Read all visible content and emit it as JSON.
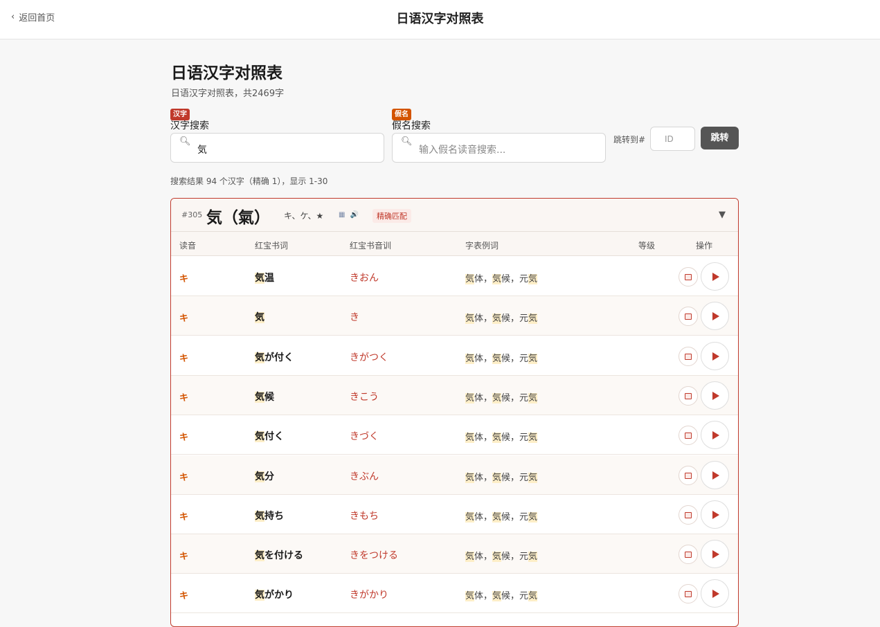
{
  "topbar": {
    "back_label": "返回首页",
    "title": "日语汉字对照表"
  },
  "page": {
    "heading": "日语汉字对照表",
    "subtitle": "日语汉字对照表，共2469字"
  },
  "kanji_search": {
    "badge": "汉字",
    "label": "汉字搜索",
    "value": "気"
  },
  "kana_search": {
    "badge": "假名",
    "label": "假名搜索",
    "placeholder": "输入假名读音搜索..."
  },
  "jump": {
    "label": "跳转到#",
    "placeholder": "ID",
    "button": "跳转"
  },
  "result_text": "搜索结果 94 个汉字（精确 1），显示 1-30",
  "card": {
    "id": "#305",
    "kanji": "気（氣）",
    "readings": "キ、ケ、★",
    "icons": "▦ 🔊",
    "match_badge": "精确匹配",
    "collapse_icon": "▼"
  },
  "table": {
    "headers": {
      "yin": "读音",
      "word": "红宝书词",
      "kana": "红宝书音训",
      "example": "字表例词",
      "level": "等级",
      "ops": "操作"
    },
    "example_parts": {
      "a": "気",
      "b": "体，",
      "c": "気",
      "d": "候，元",
      "e": "気"
    },
    "rows": [
      {
        "yin": "キ",
        "hl": "気",
        "rest": "温",
        "kana": "きおん"
      },
      {
        "yin": "キ",
        "hl": "気",
        "rest": "",
        "kana": "き"
      },
      {
        "yin": "キ",
        "hl": "気",
        "rest": "が付く",
        "kana": "きがつく"
      },
      {
        "yin": "キ",
        "hl": "気",
        "rest": "候",
        "kana": "きこう"
      },
      {
        "yin": "キ",
        "hl": "気",
        "rest": "付く",
        "kana": "きづく"
      },
      {
        "yin": "キ",
        "hl": "気",
        "rest": "分",
        "kana": "きぶん"
      },
      {
        "yin": "キ",
        "hl": "気",
        "rest": "持ち",
        "kana": "きもち"
      },
      {
        "yin": "キ",
        "hl": "気",
        "rest": "を付ける",
        "kana": "きをつける"
      },
      {
        "yin": "キ",
        "hl": "気",
        "rest": "がかり",
        "kana": "きがかり"
      }
    ]
  }
}
